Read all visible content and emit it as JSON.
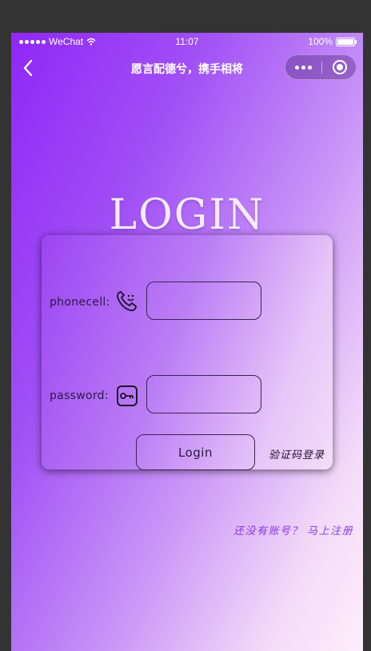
{
  "status_bar": {
    "carrier": "WeChat",
    "time": "11:07",
    "battery": "100%"
  },
  "navbar": {
    "title": "愿言配德兮，携手相将",
    "back_icon": "chevron-left-icon",
    "more_icon": "more-dots-icon",
    "close_icon": "target-circle-icon"
  },
  "heading": "LOGIN",
  "form": {
    "phone_label": "phonecell:",
    "phone_icon": "phone-icon",
    "phone_value": "",
    "password_label": "password:",
    "password_icon": "key-icon",
    "password_value": "",
    "login_label": "Login",
    "sms_login_label": "验证码登录"
  },
  "register_link": "还没有账号？ 马上注册",
  "colors": {
    "gradient_start": "#9027f7",
    "gradient_end": "#fdeefb",
    "register_link": "#8a38e8"
  }
}
